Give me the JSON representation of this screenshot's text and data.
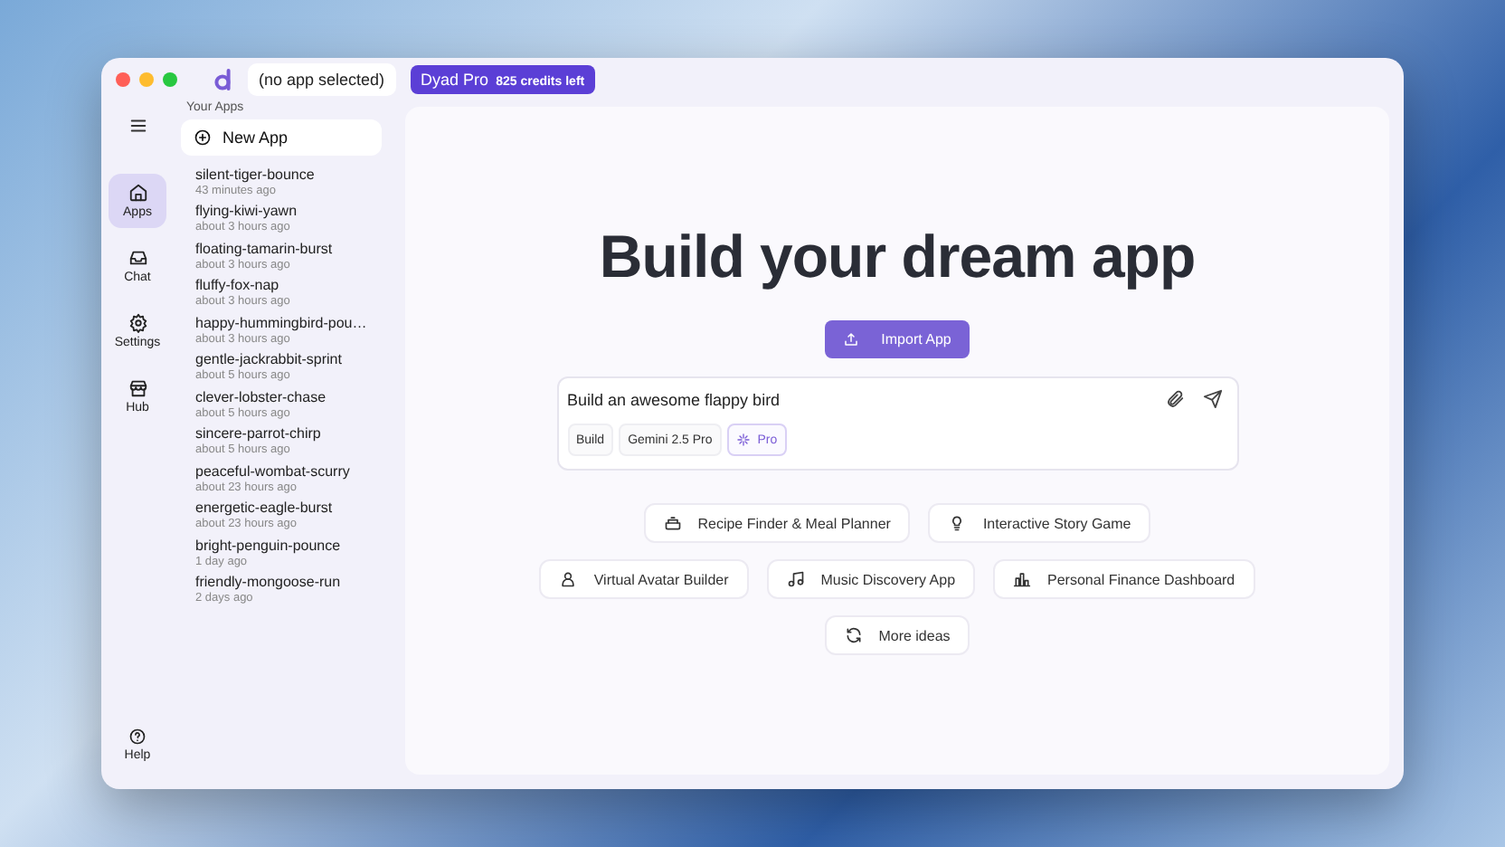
{
  "window": {
    "app_selector": "(no app selected)",
    "plan": {
      "name": "Dyad Pro",
      "credits": "825 credits left"
    }
  },
  "nav": [
    {
      "label": "Apps",
      "selected": true
    },
    {
      "label": "Chat",
      "selected": false
    },
    {
      "label": "Settings",
      "selected": false
    },
    {
      "label": "Hub",
      "selected": false
    }
  ],
  "help": {
    "label": "Help"
  },
  "apps_panel": {
    "title": "Your Apps",
    "new_app": "New App",
    "apps": [
      {
        "name": "silent-tiger-bounce",
        "time": "43 minutes ago"
      },
      {
        "name": "flying-kiwi-yawn",
        "time": "about 3 hours ago"
      },
      {
        "name": "floating-tamarin-burst",
        "time": "about 3 hours ago"
      },
      {
        "name": "fluffy-fox-nap",
        "time": "about 3 hours ago"
      },
      {
        "name": "happy-hummingbird-pou…",
        "time": "about 3 hours ago"
      },
      {
        "name": "gentle-jackrabbit-sprint",
        "time": "about 5 hours ago"
      },
      {
        "name": "clever-lobster-chase",
        "time": "about 5 hours ago"
      },
      {
        "name": "sincere-parrot-chirp",
        "time": "about 5 hours ago"
      },
      {
        "name": "peaceful-wombat-scurry",
        "time": "about 23 hours ago"
      },
      {
        "name": "energetic-eagle-burst",
        "time": "about 23 hours ago"
      },
      {
        "name": "bright-penguin-pounce",
        "time": "1 day ago"
      },
      {
        "name": "friendly-mongoose-run",
        "time": "2 days ago"
      }
    ]
  },
  "main": {
    "heading": "Build your dream app",
    "import_button": "Import App",
    "composer": {
      "value": "Build an awesome flappy bird",
      "chips": [
        {
          "label": "Build",
          "selected": false
        },
        {
          "label": "Gemini 2.5 Pro",
          "selected": false
        },
        {
          "label": "Pro",
          "selected": true
        }
      ]
    },
    "suggestion_rows": [
      [
        "Recipe Finder & Meal Planner",
        "Interactive Story Game"
      ],
      [
        "Virtual Avatar Builder",
        "Music Discovery App",
        "Personal Finance Dashboard"
      ]
    ],
    "more_ideas": "More ideas"
  }
}
